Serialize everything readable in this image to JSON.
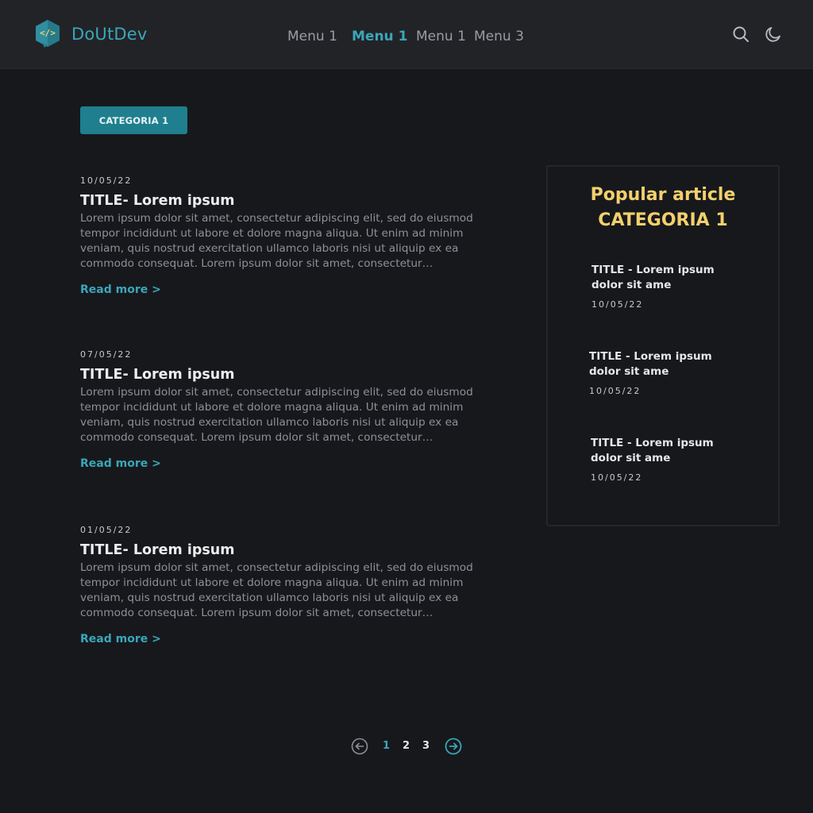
{
  "header": {
    "brand": "DoUtDev",
    "logo_glyph": "</>",
    "nav": [
      {
        "label": "Menu 1",
        "active": false
      },
      {
        "label": "Menu 1",
        "active": true
      },
      {
        "label": "Menu 1",
        "active": false
      },
      {
        "label": "Menu 3",
        "active": false
      }
    ],
    "icons": [
      "search-icon",
      "moon-icon"
    ]
  },
  "category_button": "CATEGORIA 1",
  "articles": [
    {
      "date": "10/05/22",
      "title": "TITLE- Lorem ipsum",
      "excerpt": "Lorem ipsum dolor sit amet, consectetur adipiscing elit, sed do eiusmod tempor incididunt ut labore et dolore magna aliqua. Ut enim ad minim veniam, quis nostrud exercitation ullamco laboris nisi ut aliquip ex ea commodo consequat. Lorem ipsum dolor sit amet, consectetur adipiscing elit, sed do eiusmod",
      "read_more": "Read more >"
    },
    {
      "date": "07/05/22",
      "title": "TITLE- Lorem ipsum",
      "excerpt": "Lorem ipsum dolor sit amet, consectetur adipiscing elit, sed do eiusmod tempor incididunt ut labore et dolore magna aliqua. Ut enim ad minim veniam, quis nostrud exercitation ullamco laboris nisi ut aliquip ex ea commodo consequat. Lorem ipsum dolor sit amet, consectetur adipiscing elit, sed do eiusmod",
      "read_more": "Read more >"
    },
    {
      "date": "01/05/22",
      "title": "TITLE- Lorem ipsum",
      "excerpt": "Lorem ipsum dolor sit amet, consectetur adipiscing elit, sed do eiusmod tempor incididunt ut labore et dolore magna aliqua. Ut enim ad minim veniam, quis nostrud exercitation ullamco laboris nisi ut aliquip ex ea commodo consequat. Lorem ipsum dolor sit amet, consectetur adipiscing elit, sed do eiusmod",
      "read_more": "Read more >"
    }
  ],
  "sidebar": {
    "title_line1": "Popular article",
    "title_line2": "CATEGORIA 1",
    "items": [
      {
        "title": "TITLE - Lorem ipsum dolor sit ame",
        "date": "10/05/22"
      },
      {
        "title": "TITLE - Lorem ipsum dolor sit ame",
        "date": "10/05/22"
      },
      {
        "title": "TITLE - Lorem ipsum dolor sit ame",
        "date": "10/05/22"
      }
    ]
  },
  "pagination": {
    "pages": [
      "1",
      "2",
      "3"
    ],
    "current": "1",
    "icons": [
      "arrow-left-circle-icon",
      "arrow-right-circle-icon"
    ]
  },
  "colors": {
    "background": "#17181c",
    "header": "#222327",
    "accent": "#3aa6b9",
    "highlight": "#f3d06c"
  }
}
